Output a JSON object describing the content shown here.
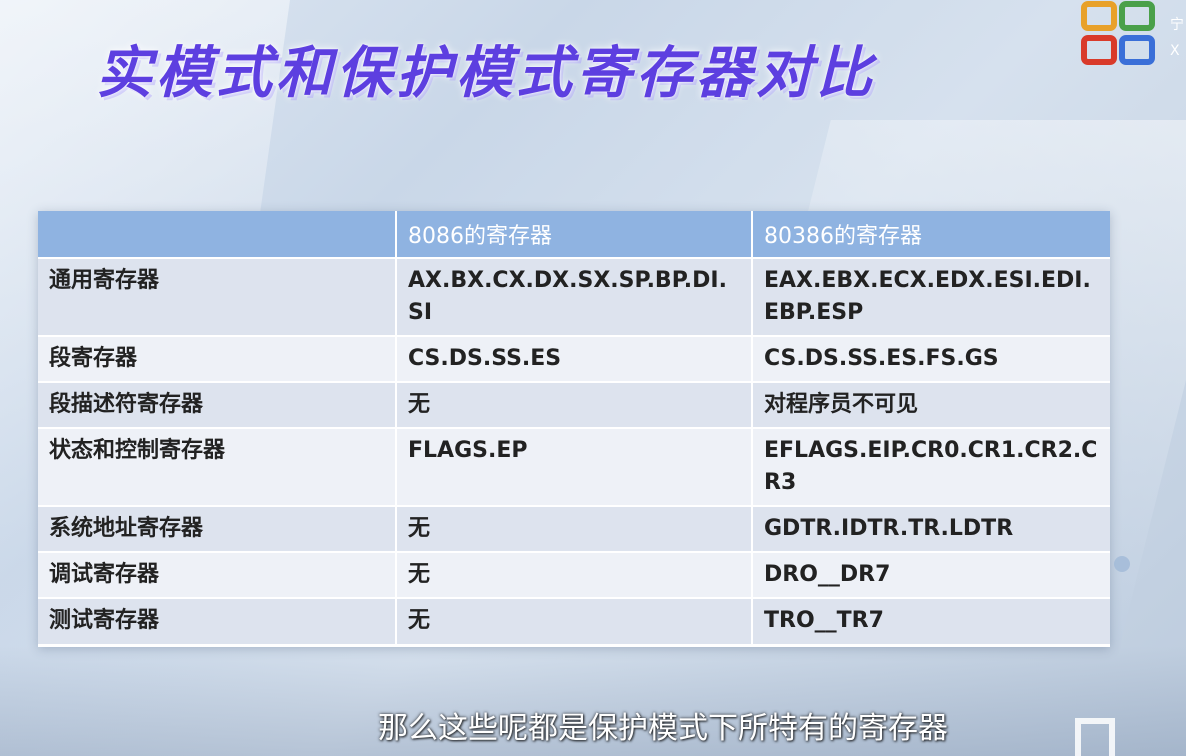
{
  "title": "实模式和保护模式寄存器对比",
  "table": {
    "headers": [
      "",
      "8086的寄存器",
      "80386的寄存器"
    ],
    "rows": [
      {
        "name": "通用寄存器",
        "r8086": "AX.BX.CX.DX.SX.SP.BP.DI.SI",
        "r80386": "EAX.EBX.ECX.EDX.ESI.EDI.EBP.ESP"
      },
      {
        "name": "段寄存器",
        "r8086": "CS.DS.SS.ES",
        "r80386": "CS.DS.SS.ES.FS.GS"
      },
      {
        "name": "段描述符寄存器",
        "r8086": "无",
        "r80386": "对程序员不可见"
      },
      {
        "name": "状态和控制寄存器",
        "r8086": "FLAGS.EP",
        "r80386": "EFLAGS.EIP.CR0.CR1.CR2.CR3"
      },
      {
        "name": "系统地址寄存器",
        "r8086": "无",
        "r80386": "GDTR.IDTR.TR.LDTR"
      },
      {
        "name": "调试寄存器",
        "r8086": "无",
        "r80386": "DRO__DR7"
      },
      {
        "name": "测试寄存器",
        "r8086": "无",
        "r80386": "TRO__TR7"
      }
    ]
  },
  "subtitle": "那么这些呢都是保护模式下所特有的寄存器",
  "logo": {
    "icon": "grid-logo-icon",
    "colors": [
      "#e8a12a",
      "#4aa04a",
      "#3a6fd8",
      "#d93a2a"
    ],
    "tail_text": [
      "宁",
      "X"
    ]
  },
  "colors": {
    "title": "#5d3fe0",
    "header_bg": "#8fb3e1",
    "row_odd": "#dde3ee",
    "row_even": "#eef1f7"
  }
}
